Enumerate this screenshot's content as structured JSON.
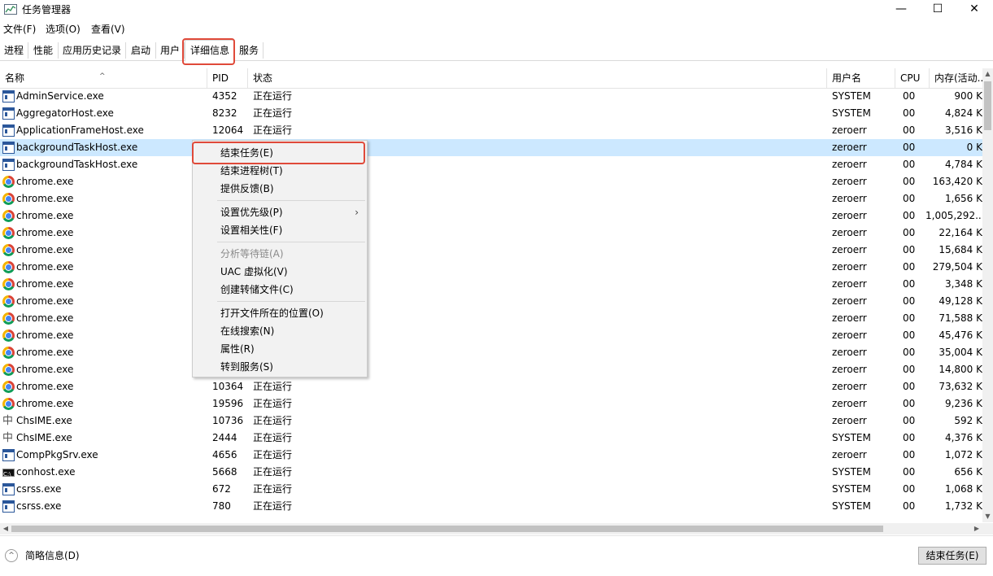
{
  "window": {
    "title": "任务管理器",
    "minimize": "—",
    "maximize": "☐",
    "close": "✕"
  },
  "menu": [
    {
      "label": "文件(F)"
    },
    {
      "label": "选项(O)"
    },
    {
      "label": "查看(V)"
    }
  ],
  "tabs": [
    {
      "label": "进程"
    },
    {
      "label": "性能"
    },
    {
      "label": "应用历史记录"
    },
    {
      "label": "启动"
    },
    {
      "label": "用户"
    },
    {
      "label": "详细信息"
    },
    {
      "label": "服务"
    }
  ],
  "active_tab": "详细信息",
  "columns": {
    "name": "名称",
    "pid": "PID",
    "status": "状态",
    "user": "用户名",
    "cpu": "CPU",
    "mem": "内存(活动..."
  },
  "rows": [
    {
      "name": "AdminService.exe",
      "pid": "4352",
      "status": "正在运行",
      "user": "SYSTEM",
      "cpu": "00",
      "mem": "900 K",
      "icon": "service-icon"
    },
    {
      "name": "AggregatorHost.exe",
      "pid": "8232",
      "status": "正在运行",
      "user": "SYSTEM",
      "cpu": "00",
      "mem": "4,824 K",
      "icon": "service-icon"
    },
    {
      "name": "ApplicationFrameHost.exe",
      "pid": "12064",
      "status": "正在运行",
      "user": "zeroerr",
      "cpu": "00",
      "mem": "3,516 K",
      "icon": "service-icon"
    },
    {
      "name": "backgroundTaskHost.exe",
      "pid": "",
      "status": "",
      "user": "zeroerr",
      "cpu": "00",
      "mem": "0 K",
      "icon": "service-icon",
      "selected": true
    },
    {
      "name": "backgroundTaskHost.exe",
      "pid": "",
      "status": "",
      "user": "zeroerr",
      "cpu": "00",
      "mem": "4,784 K",
      "icon": "service-icon"
    },
    {
      "name": "chrome.exe",
      "pid": "",
      "status": "",
      "user": "zeroerr",
      "cpu": "00",
      "mem": "163,420 K",
      "icon": "chrome-icon"
    },
    {
      "name": "chrome.exe",
      "pid": "",
      "status": "",
      "user": "zeroerr",
      "cpu": "00",
      "mem": "1,656 K",
      "icon": "chrome-icon"
    },
    {
      "name": "chrome.exe",
      "pid": "",
      "status": "",
      "user": "zeroerr",
      "cpu": "00",
      "mem": "1,005,292...",
      "icon": "chrome-icon"
    },
    {
      "name": "chrome.exe",
      "pid": "",
      "status": "",
      "user": "zeroerr",
      "cpu": "00",
      "mem": "22,164 K",
      "icon": "chrome-icon"
    },
    {
      "name": "chrome.exe",
      "pid": "",
      "status": "",
      "user": "zeroerr",
      "cpu": "00",
      "mem": "15,684 K",
      "icon": "chrome-icon"
    },
    {
      "name": "chrome.exe",
      "pid": "",
      "status": "",
      "user": "zeroerr",
      "cpu": "00",
      "mem": "279,504 K",
      "icon": "chrome-icon"
    },
    {
      "name": "chrome.exe",
      "pid": "",
      "status": "",
      "user": "zeroerr",
      "cpu": "00",
      "mem": "3,348 K",
      "icon": "chrome-icon"
    },
    {
      "name": "chrome.exe",
      "pid": "",
      "status": "",
      "user": "zeroerr",
      "cpu": "00",
      "mem": "49,128 K",
      "icon": "chrome-icon"
    },
    {
      "name": "chrome.exe",
      "pid": "",
      "status": "",
      "user": "zeroerr",
      "cpu": "00",
      "mem": "71,588 K",
      "icon": "chrome-icon"
    },
    {
      "name": "chrome.exe",
      "pid": "",
      "status": "",
      "user": "zeroerr",
      "cpu": "00",
      "mem": "45,476 K",
      "icon": "chrome-icon"
    },
    {
      "name": "chrome.exe",
      "pid": "",
      "status": "",
      "user": "zeroerr",
      "cpu": "00",
      "mem": "35,004 K",
      "icon": "chrome-icon"
    },
    {
      "name": "chrome.exe",
      "pid": "",
      "status": "",
      "user": "zeroerr",
      "cpu": "00",
      "mem": "14,800 K",
      "icon": "chrome-icon"
    },
    {
      "name": "chrome.exe",
      "pid": "10364",
      "status": "正在运行",
      "user": "zeroerr",
      "cpu": "00",
      "mem": "73,632 K",
      "icon": "chrome-icon"
    },
    {
      "name": "chrome.exe",
      "pid": "19596",
      "status": "正在运行",
      "user": "zeroerr",
      "cpu": "00",
      "mem": "9,236 K",
      "icon": "chrome-icon"
    },
    {
      "name": "ChsIME.exe",
      "pid": "10736",
      "status": "正在运行",
      "user": "zeroerr",
      "cpu": "00",
      "mem": "592 K",
      "icon": "ime-icon"
    },
    {
      "name": "ChsIME.exe",
      "pid": "2444",
      "status": "正在运行",
      "user": "SYSTEM",
      "cpu": "00",
      "mem": "4,376 K",
      "icon": "ime-icon"
    },
    {
      "name": "CompPkgSrv.exe",
      "pid": "4656",
      "status": "正在运行",
      "user": "zeroerr",
      "cpu": "00",
      "mem": "1,072 K",
      "icon": "service-icon"
    },
    {
      "name": "conhost.exe",
      "pid": "5668",
      "status": "正在运行",
      "user": "SYSTEM",
      "cpu": "00",
      "mem": "656 K",
      "icon": "console-icon"
    },
    {
      "name": "csrss.exe",
      "pid": "672",
      "status": "正在运行",
      "user": "SYSTEM",
      "cpu": "00",
      "mem": "1,068 K",
      "icon": "service-icon"
    },
    {
      "name": "csrss.exe",
      "pid": "780",
      "status": "正在运行",
      "user": "SYSTEM",
      "cpu": "00",
      "mem": "1,732 K",
      "icon": "service-icon"
    }
  ],
  "context_menu": {
    "items": [
      {
        "label": "结束任务(E)",
        "highlighted": true
      },
      {
        "label": "结束进程树(T)"
      },
      {
        "label": "提供反馈(B)"
      },
      {
        "label": "设置优先级(P)",
        "submenu": true
      },
      {
        "label": "设置相关性(F)"
      },
      {
        "label": "分析等待链(A)",
        "disabled": true
      },
      {
        "label": "UAC 虚拟化(V)"
      },
      {
        "label": "创建转储文件(C)"
      },
      {
        "label": "打开文件所在的位置(O)"
      },
      {
        "label": "在线搜索(N)"
      },
      {
        "label": "属性(R)"
      },
      {
        "label": "转到服务(S)"
      }
    ]
  },
  "footer": {
    "fewer_details": "简略信息(D)",
    "end_task": "结束任务(E)"
  },
  "colors": {
    "selection": "#cce8ff",
    "annotation": "#e04a3a"
  }
}
